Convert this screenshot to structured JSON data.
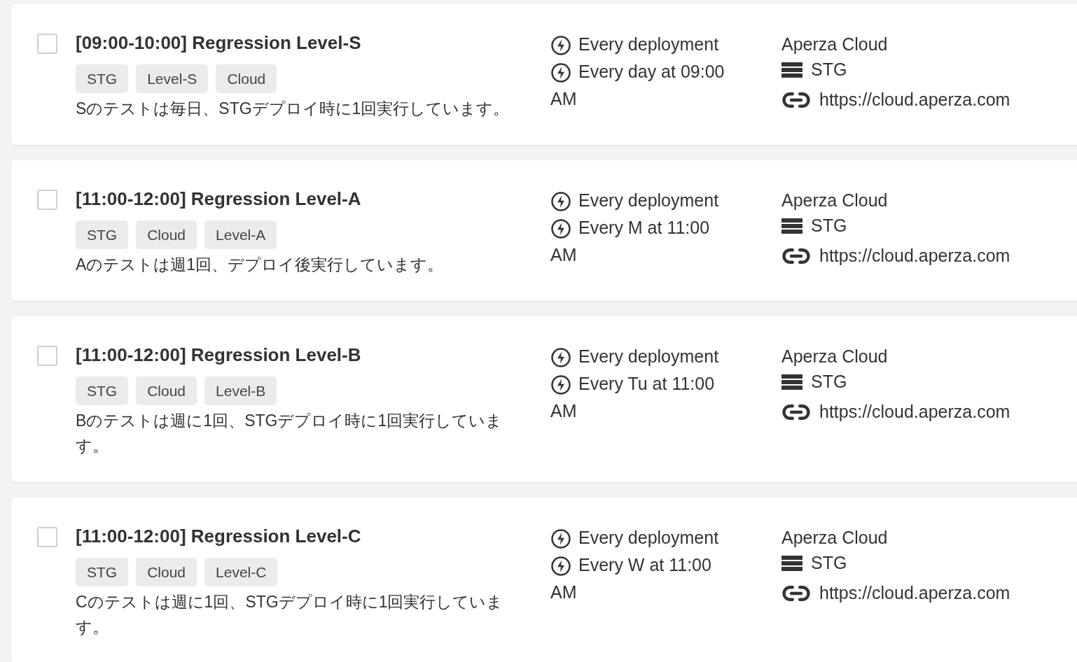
{
  "tests": [
    {
      "checked": false,
      "title": "[09:00-10:00] Regression Level-S",
      "tags": [
        "STG",
        "Level-S",
        "Cloud"
      ],
      "description": "Sのテストは毎日、STGデプロイ時に1回実行しています。",
      "triggers": [
        "Every deployment",
        "Every day at 09:00 AM"
      ],
      "project": "Aperza Cloud",
      "environment": "STG",
      "url": "https://cloud.aperza.com"
    },
    {
      "checked": false,
      "title": "[11:00-12:00] Regression Level-A",
      "tags": [
        "STG",
        "Cloud",
        "Level-A"
      ],
      "description": "Aのテストは週1回、デプロイ後実行しています。",
      "triggers": [
        "Every deployment",
        "Every M at 11:00 AM"
      ],
      "project": "Aperza Cloud",
      "environment": "STG",
      "url": "https://cloud.aperza.com"
    },
    {
      "checked": false,
      "title": "[11:00-12:00] Regression Level-B",
      "tags": [
        "STG",
        "Cloud",
        "Level-B"
      ],
      "description": "Bのテストは週に1回、STGデプロイ時に1回実行しています。",
      "triggers": [
        "Every deployment",
        "Every Tu at 11:00 AM"
      ],
      "project": "Aperza Cloud",
      "environment": "STG",
      "url": "https://cloud.aperza.com"
    },
    {
      "checked": false,
      "title": "[11:00-12:00] Regression Level-C",
      "tags": [
        "STG",
        "Cloud",
        "Level-C"
      ],
      "description": "Cのテストは週に1回、STGデプロイ時に1回実行しています。",
      "triggers": [
        "Every deployment",
        "Every W at 11:00 AM"
      ],
      "project": "Aperza Cloud",
      "environment": "STG",
      "url": "https://cloud.aperza.com"
    }
  ]
}
